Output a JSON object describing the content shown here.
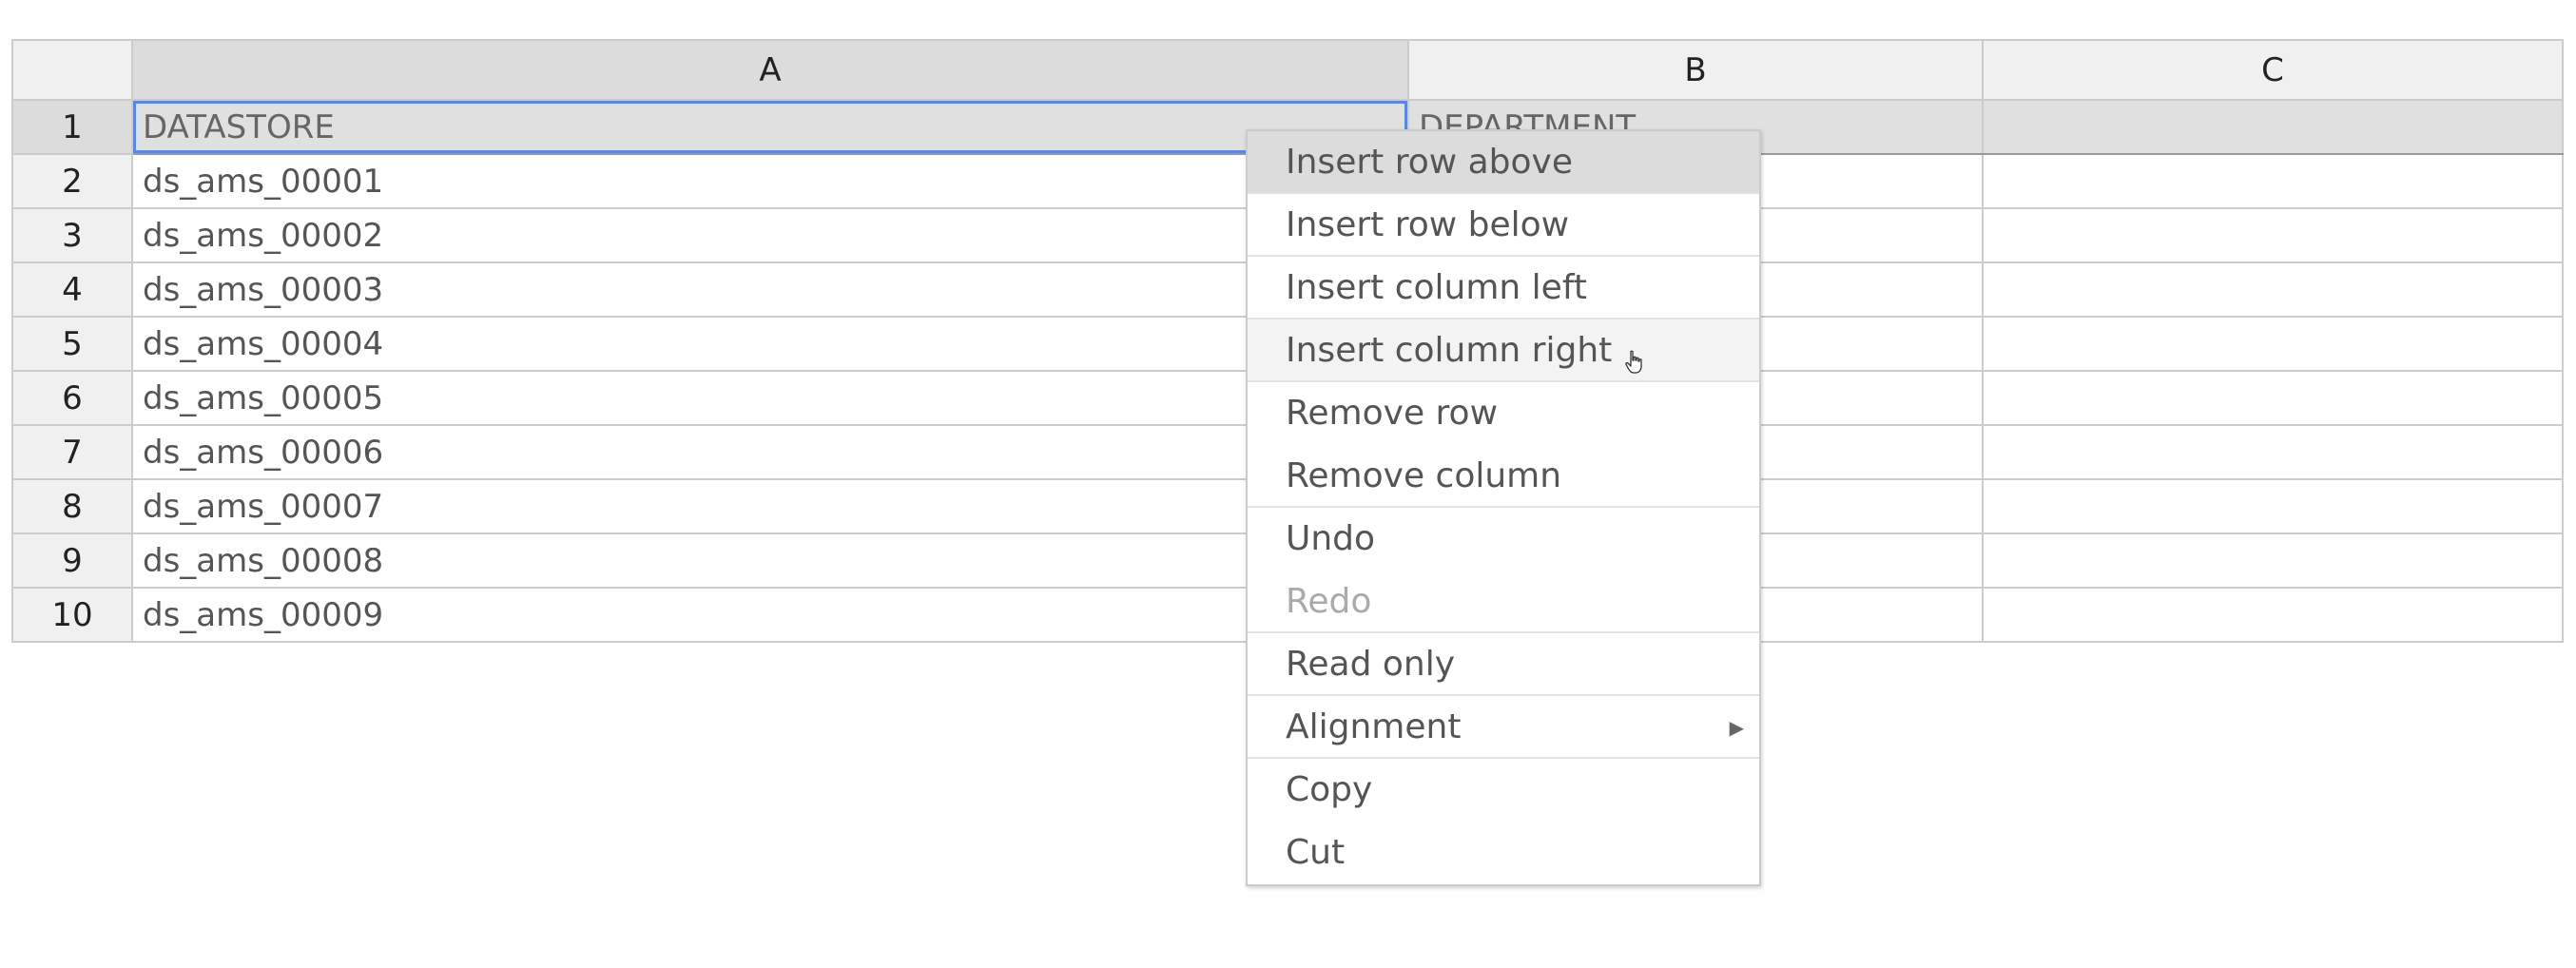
{
  "grid": {
    "columns": [
      "A",
      "B",
      "C"
    ],
    "rows": [
      {
        "num": "1",
        "a": "DATASTORE",
        "b": "DEPARTMENT",
        "c": ""
      },
      {
        "num": "2",
        "a": "ds_ams_00001",
        "b": "",
        "c": ""
      },
      {
        "num": "3",
        "a": "ds_ams_00002",
        "b": "",
        "c": ""
      },
      {
        "num": "4",
        "a": "ds_ams_00003",
        "b": "",
        "c": ""
      },
      {
        "num": "5",
        "a": "ds_ams_00004",
        "b": "",
        "c": ""
      },
      {
        "num": "6",
        "a": "ds_ams_00005",
        "b": "",
        "c": ""
      },
      {
        "num": "7",
        "a": "ds_ams_00006",
        "b": "",
        "c": ""
      },
      {
        "num": "8",
        "a": "ds_ams_00007",
        "b": "",
        "c": ""
      },
      {
        "num": "9",
        "a": "ds_ams_00008",
        "b": "",
        "c": ""
      },
      {
        "num": "10",
        "a": "ds_ams_00009",
        "b": "",
        "c": ""
      }
    ],
    "selected_cell": "A1"
  },
  "context_menu": {
    "items": [
      {
        "label": "Insert row above"
      },
      {
        "label": "Insert row below"
      },
      {
        "label": "Insert column left"
      },
      {
        "label": "Insert column right"
      },
      {
        "label": "Remove row"
      },
      {
        "label": "Remove column"
      },
      {
        "label": "Undo"
      },
      {
        "label": "Redo"
      },
      {
        "label": "Read only"
      },
      {
        "label": "Alignment",
        "submenu_icon": "triangle-right-icon"
      },
      {
        "label": "Copy"
      },
      {
        "label": "Cut"
      }
    ]
  },
  "colors": {
    "selection_border": "#4b89ff",
    "header_bg": "#f0f0f0",
    "selected_header_bg": "#dcdcdc",
    "menu_highlight": "#dcdcdc"
  },
  "icons": {
    "cursor": "hand-pointer-icon",
    "submenu": "triangle-right-icon"
  }
}
